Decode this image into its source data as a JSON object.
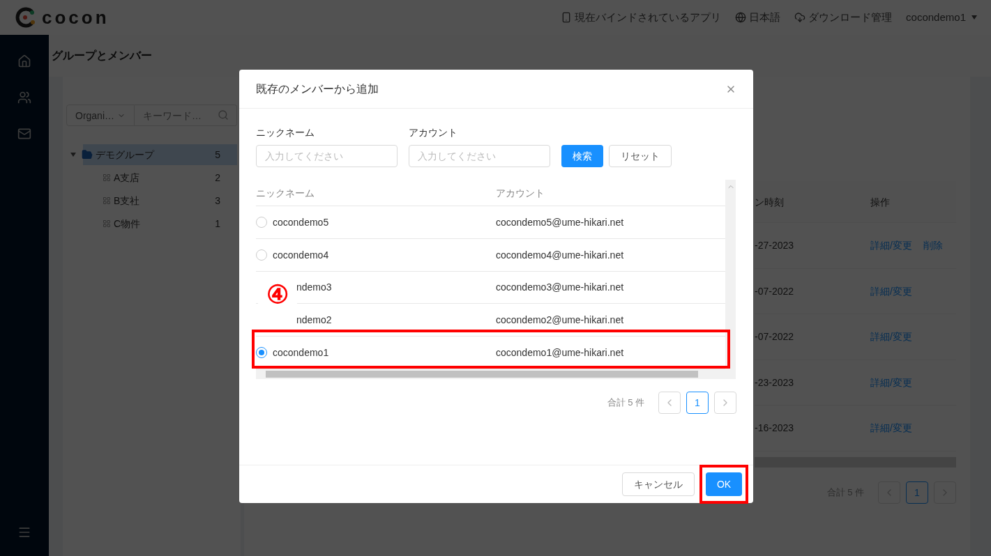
{
  "header": {
    "logo": "cocon",
    "links": [
      {
        "kind": "device",
        "label": "現在バインドされているアプリ"
      },
      {
        "kind": "language",
        "label": "日本語"
      },
      {
        "kind": "download",
        "label": "ダウンロード管理"
      }
    ],
    "user": "cocondemo1"
  },
  "page_title": "グループとメンバー",
  "filter": {
    "select": "Organi…",
    "placeholder": "キーワード…"
  },
  "tree": [
    {
      "label": "デモグループ",
      "count": "5",
      "expanded": true,
      "selected": true,
      "children": [
        {
          "label": "A支店",
          "count": "2",
          "selected": false
        },
        {
          "label": "B支社",
          "count": "3",
          "selected": false
        },
        {
          "label": "C物件",
          "count": "1",
          "selected": false
        }
      ]
    }
  ],
  "members_table": {
    "columns": [
      "ン時刻",
      "操作"
    ],
    "rows": [
      {
        "time": "-27-2023",
        "actions": [
          "詳細/変更",
          "削除"
        ]
      },
      {
        "time": "-07-2022",
        "actions": [
          "詳細/変更"
        ]
      },
      {
        "time": "-07-2022",
        "actions": [
          "詳細/変更"
        ]
      },
      {
        "time": "-23-2023",
        "actions": [
          "詳細/変更"
        ]
      },
      {
        "time": "-16-2023",
        "actions": [
          "詳細/変更"
        ]
      }
    ],
    "pagination": {
      "total": "合計 5 件",
      "pages": [
        {
          "label": "1",
          "selected": true
        }
      ]
    }
  },
  "dialog": {
    "title": "既存のメンバーから追加",
    "fields": [
      {
        "label": "ニックネーム",
        "placeholder": "入力してください"
      },
      {
        "label": "アカウント",
        "placeholder": "入力してください"
      }
    ],
    "search_button": "検索",
    "reset_button": "リセット",
    "columns": [
      "ニックネーム",
      "アカウント"
    ],
    "rows": [
      {
        "kind": "radio",
        "nickname": "cocondemo5",
        "account": "cocondemo5@ume-hikari.net",
        "selected": false,
        "highlighted": false
      },
      {
        "kind": "radio",
        "nickname": "cocondemo4",
        "account": "cocondemo4@ume-hikari.net",
        "selected": false,
        "highlighted": false
      },
      {
        "kind": "covered",
        "nickname": "ndemo3",
        "account": "cocondemo3@ume-hikari.net"
      },
      {
        "kind": "covered",
        "nickname": "ndemo2",
        "account": "cocondemo2@ume-hikari.net"
      },
      {
        "kind": "radio",
        "nickname": "cocondemo1",
        "account": "cocondemo1@ume-hikari.net",
        "selected": true,
        "highlighted": true
      }
    ],
    "pagination": {
      "total": "合計 5 件",
      "pages": [
        {
          "label": "1",
          "selected": true
        }
      ]
    },
    "cancel_button": "キャンセル",
    "ok_button": {
      "label": "OK",
      "highlighted": true
    }
  },
  "annotation": {
    "label": "④"
  }
}
